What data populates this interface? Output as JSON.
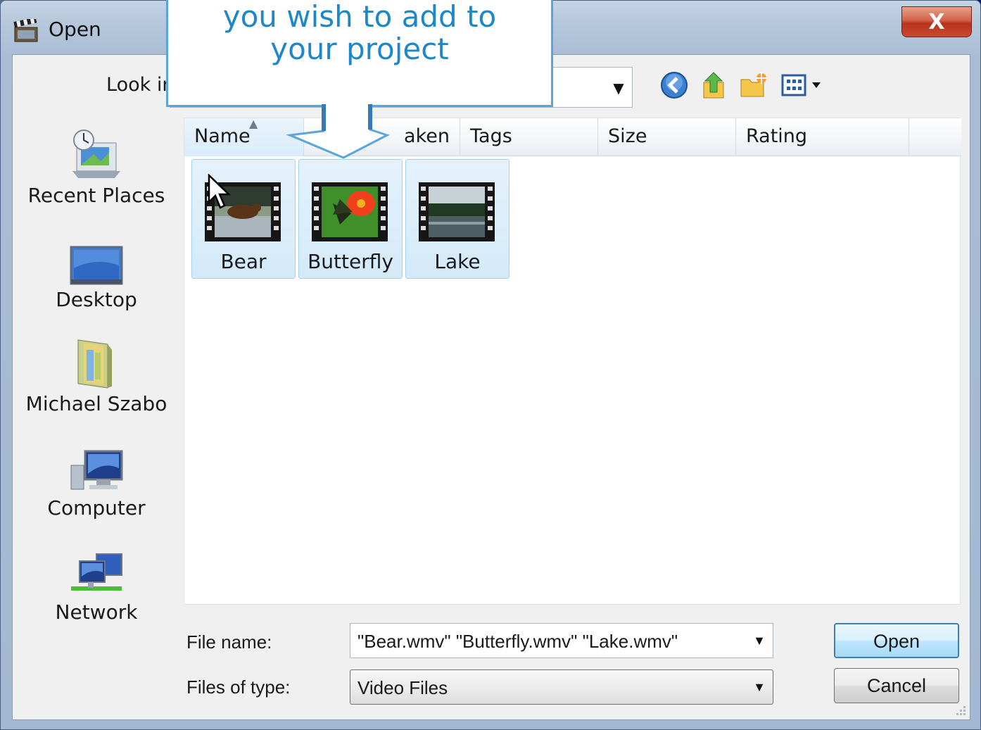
{
  "window": {
    "title": "Open",
    "close_label": "X"
  },
  "toolbar": {
    "look_in_label": "Look in:",
    "look_in_value": "",
    "back_icon": "back-arrow-icon",
    "up_icon": "up-folder-icon",
    "new_folder_icon": "new-folder-icon",
    "views_icon": "views-menu-icon"
  },
  "callout": {
    "line1": "you wish to add to",
    "line2": "your project"
  },
  "places": [
    {
      "label": "Recent Places",
      "icon": "recent-places-icon"
    },
    {
      "label": "Desktop",
      "icon": "desktop-icon"
    },
    {
      "label": "Michael Szabo",
      "icon": "user-folder-icon"
    },
    {
      "label": "Computer",
      "icon": "computer-icon"
    },
    {
      "label": "Network",
      "icon": "network-icon"
    }
  ],
  "columns": [
    "Name",
    "aken",
    "Tags",
    "Size",
    "Rating"
  ],
  "files": [
    {
      "label": "Bear",
      "icon": "video-file-icon"
    },
    {
      "label": "Butterfly",
      "icon": "video-file-icon"
    },
    {
      "label": "Lake",
      "icon": "video-file-icon"
    }
  ],
  "form": {
    "file_name_label": "File name:",
    "file_name_value": "\"Bear.wmv\" \"Butterfly.wmv\" \"Lake.wmv\"",
    "file_type_label": "Files of type:",
    "file_type_value": "Video Files"
  },
  "buttons": {
    "open": "Open",
    "cancel": "Cancel"
  },
  "colors": {
    "callout_text": "#1e87c8",
    "callout_border": "#5aa5de",
    "selection": "#d4eaf9",
    "close_button": "#c94b31"
  }
}
